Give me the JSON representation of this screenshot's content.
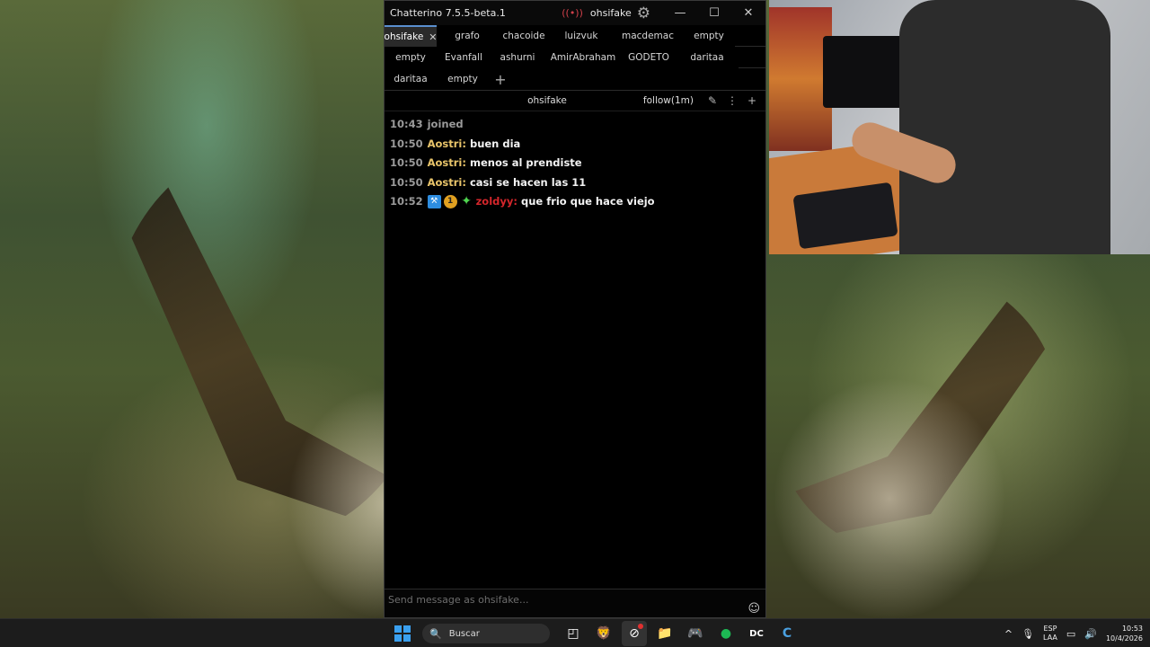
{
  "window": {
    "title": "Chatterino 7.5.5-beta.1",
    "live_icon": "((•))",
    "username": "ohsifake",
    "controls": {
      "minimize": "—",
      "maximize": "☐",
      "close": "✕"
    }
  },
  "tabs": {
    "row1": [
      "ohsifake",
      "grafo",
      "chacoide",
      "luizvuk",
      "macdemac",
      "empty"
    ],
    "row2": [
      "empty",
      "Evanfall",
      "ashurni",
      "AmirAbraham",
      "GODETO",
      "daritaa"
    ],
    "row3": [
      "daritaa",
      "empty"
    ],
    "selected_close": "✕",
    "add_tab": "+"
  },
  "split": {
    "channel": "ohsifake",
    "mode": "follow(1m)",
    "icons": {
      "edit": "✎",
      "menu": "⋮",
      "add": "+"
    }
  },
  "messages": [
    {
      "time": "10:43",
      "system": "joined"
    },
    {
      "time": "10:50",
      "user": "Aostri:",
      "user_color": "#e8c46a",
      "text": "buen dia"
    },
    {
      "time": "10:50",
      "user": "Aostri:",
      "user_color": "#e8c46a",
      "text": "menos al prendiste"
    },
    {
      "time": "10:50",
      "user": "Aostri:",
      "user_color": "#e8c46a",
      "text": "casi se hacen las 11"
    },
    {
      "time": "10:52",
      "user": "zoldyy:",
      "user_color": "#d4262b",
      "text": "que frio que hace viejo"
    }
  ],
  "input": {
    "placeholder": "Send message as ohsifake...",
    "emoji_icon": "☺"
  },
  "taskbar": {
    "search_placeholder": "Buscar",
    "search_icon": "🔍",
    "apps": [
      "◰",
      "🦁",
      "⊘",
      "📁",
      "🎮",
      "●",
      "DC",
      "C"
    ],
    "lang_top": "ESP",
    "lang_bottom": "LAA",
    "time": "10:53",
    "date": "10/4/2026",
    "tray": {
      "chevron": "^",
      "mic": "🎙",
      "display": "▭",
      "volume": "🔊"
    }
  }
}
